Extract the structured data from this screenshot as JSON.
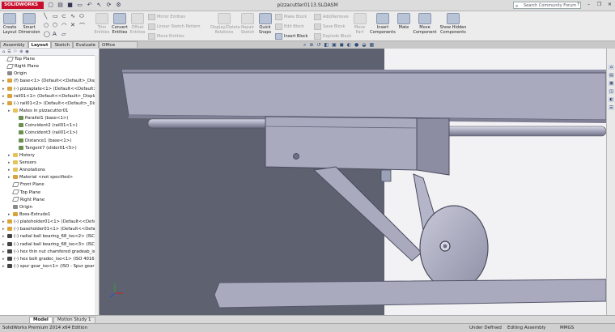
{
  "app": {
    "brand": "SOLIDWORKS",
    "document_title": "pizzacutter0113.SLDASM",
    "search_placeholder": "Search Community Forum"
  },
  "ribbon": {
    "create_layout": "Create Layout",
    "smart_dimension": "Smart Dimension",
    "trim_entities": "Trim Entities",
    "convert_entities": "Convert Entities",
    "offset_entities": "Offset Entities",
    "mirror_entities": "Mirror Entities",
    "linear_sketch_pattern": "Linear Sketch Pattern",
    "move_entities": "Move Entities",
    "display_delete_relations": "Display/Delete Relations",
    "repair_sketch": "Repair Sketch",
    "quick_snaps": "Quick Snaps",
    "make_block": "Make Block",
    "edit_block": "Edit Block",
    "insert_block": "Insert Block",
    "add_remove": "Add/Remove",
    "save_block": "Save Block",
    "explode_block": "Explode Block",
    "move_part": "Move Part",
    "insert_components": "Insert Components",
    "mate": "Mate",
    "move_component": "Move Component",
    "show_hidden_components": "Show Hidden Components"
  },
  "tabs": [
    "Assembly",
    "Layout",
    "Sketch",
    "Evaluate",
    "Office Products"
  ],
  "tree": [
    {
      "label": "Top Plane",
      "depth": 0,
      "icon": "plane"
    },
    {
      "label": "Right Plane",
      "depth": 0,
      "icon": "plane"
    },
    {
      "label": "Origin",
      "depth": 0,
      "icon": "origin"
    },
    {
      "label": "(f) base<1> (Default<<Default>_Disp",
      "depth": 0,
      "icon": "part"
    },
    {
      "label": "(-) pizzaplate<1> (Default<<Default>_",
      "depth": 0,
      "icon": "part"
    },
    {
      "label": "rail01<1> (Default<<Default>_Display",
      "depth": 0,
      "icon": "part"
    },
    {
      "label": "(-) rail01<2> (Default<<Default>_Dis",
      "depth": 0,
      "icon": "part"
    },
    {
      "label": "Mates in pizzacutter01",
      "depth": 1,
      "icon": "fold"
    },
    {
      "label": "Parallel1 (base<1>)",
      "depth": 2,
      "icon": "mate"
    },
    {
      "label": "Coincident2 (rail01<1>)",
      "depth": 2,
      "icon": "mate"
    },
    {
      "label": "Coincident3 (rail01<1>)",
      "depth": 2,
      "icon": "mate"
    },
    {
      "label": "Distance1 (base<1>)",
      "depth": 2,
      "icon": "mate"
    },
    {
      "label": "Tangent7 (slider01<5>)",
      "depth": 2,
      "icon": "mate"
    },
    {
      "label": "History",
      "depth": 1,
      "icon": "fold"
    },
    {
      "label": "Sensors",
      "depth": 1,
      "icon": "fold"
    },
    {
      "label": "Annotations",
      "depth": 1,
      "icon": "fold"
    },
    {
      "label": "Material <not specified>",
      "depth": 1,
      "icon": "part"
    },
    {
      "label": "Front Plane",
      "depth": 1,
      "icon": "plane"
    },
    {
      "label": "Top Plane",
      "depth": 1,
      "icon": "plane"
    },
    {
      "label": "Right Plane",
      "depth": 1,
      "icon": "plane"
    },
    {
      "label": "Origin",
      "depth": 1,
      "icon": "origin"
    },
    {
      "label": "Boss-Extrude1",
      "depth": 1,
      "icon": "part"
    },
    {
      "label": "(-) plateholder01<1> (Default<<Defa",
      "depth": 0,
      "icon": "part"
    },
    {
      "label": "(-) baseholder01<1> (Default<<Defa",
      "depth": 0,
      "icon": "part"
    },
    {
      "label": "(-) radial ball bearing_68_iso<2> (ISC",
      "depth": 0,
      "icon": "bolt"
    },
    {
      "label": "(-) radial ball bearing_68_iso<3> (ISC",
      "depth": 0,
      "icon": "bolt"
    },
    {
      "label": "(-) hex thin nut chamfered gradeab_is",
      "depth": 0,
      "icon": "bolt"
    },
    {
      "label": "(-) hex bolt gradec_iso<1> (ISO 4016",
      "depth": 0,
      "icon": "bolt"
    },
    {
      "label": "(-) spur gear_iso<1> (ISO - Spur gear",
      "depth": 0,
      "icon": "bolt"
    }
  ],
  "bottom_tabs": [
    "Model",
    "Motion Study 1"
  ],
  "status": {
    "edition": "SolidWorks Premium 2014 x64 Edition",
    "definition": "Under Defined",
    "mode": "Editing Assembly",
    "units": "MMGS"
  },
  "colors": {
    "viewport_dark": "#5e6170",
    "viewport_light": "#f2f2f4",
    "part_face": "#a9aabe",
    "brand_red": "#c8102e"
  }
}
